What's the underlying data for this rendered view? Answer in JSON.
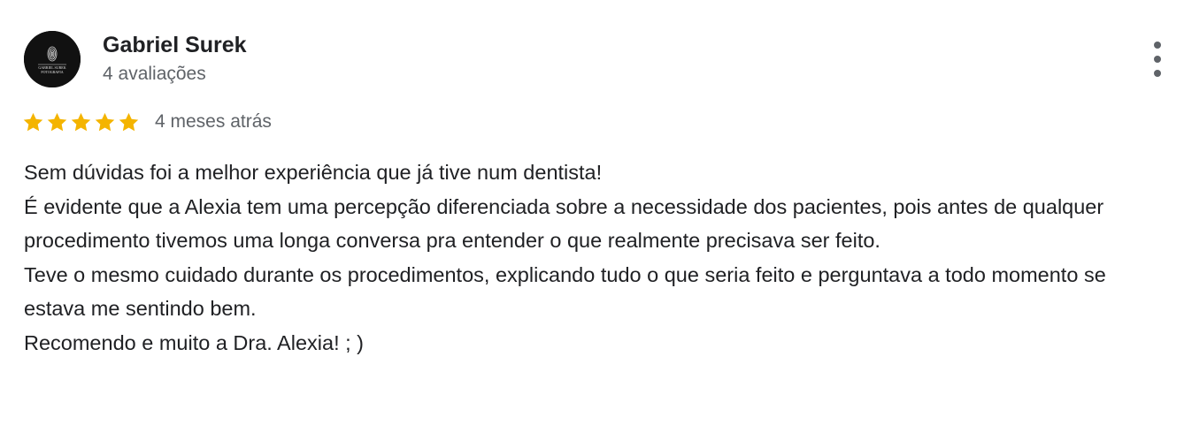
{
  "review": {
    "author": {
      "name": "Gabriel Surek",
      "review_count": "4 avaliações",
      "avatar_text_line1": "GABRIEL SUREK",
      "avatar_text_line2": "FOTOGRAFIA"
    },
    "rating": {
      "stars": 5,
      "max_stars": 5,
      "star_color": "#f4b400"
    },
    "date": "4 meses atrás",
    "text_paragraphs": [
      "Sem dúvidas foi a melhor experiência que já tive num dentista!",
      "É evidente que a Alexia tem uma percepção diferenciada sobre a necessidade dos pacientes, pois antes de qualquer procedimento tivemos uma longa conversa pra entender o que realmente precisava ser feito.",
      "Teve o mesmo cuidado durante os procedimentos, explicando tudo o que seria feito e perguntava a todo momento se estava me sentindo bem.",
      "Recomendo e muito a Dra. Alexia! ; )"
    ]
  },
  "icons": {
    "more": "more-vert-icon",
    "star": "star-icon"
  }
}
